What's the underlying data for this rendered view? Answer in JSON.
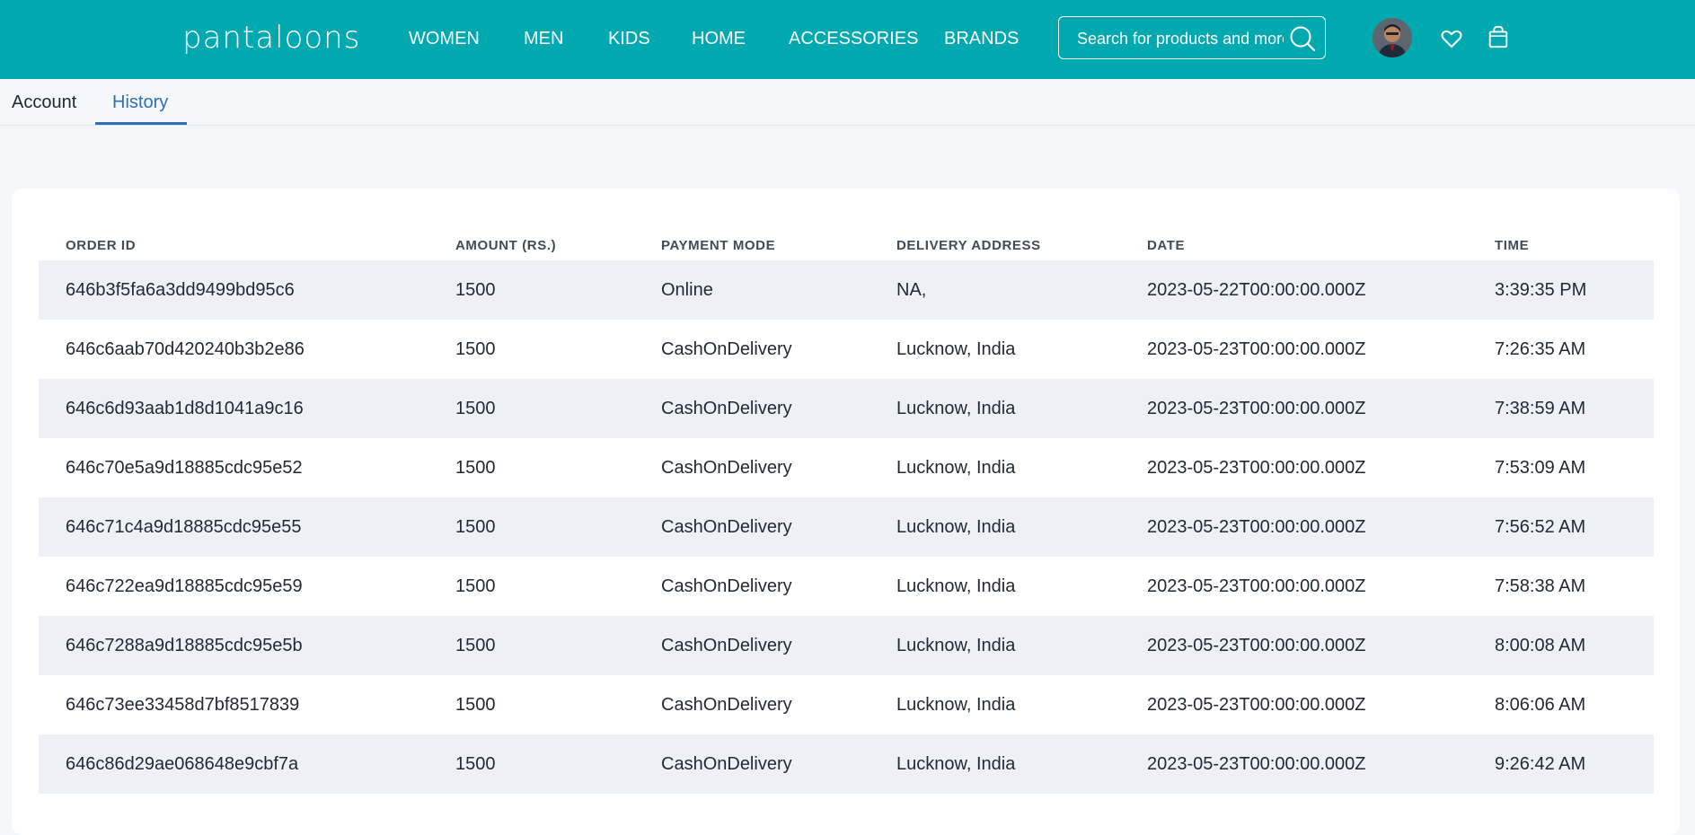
{
  "header": {
    "logo": "pantaloons",
    "nav": [
      "WOMEN",
      "MEN",
      "KIDS",
      "HOME",
      "ACCESSORIES",
      "BRANDS"
    ],
    "search_placeholder": "Search for products and more...",
    "icons": [
      "search-icon",
      "avatar",
      "heart-icon",
      "shopping-bag-icon"
    ],
    "brand_color": "#00a8b0"
  },
  "tabs": [
    {
      "label": "Account",
      "active": false
    },
    {
      "label": "History",
      "active": true
    }
  ],
  "table": {
    "columns": [
      "ORDER ID",
      "AMOUNT (RS.)",
      "PAYMENT MODE",
      "DELIVERY ADDRESS",
      "DATE",
      "TIME"
    ],
    "rows": [
      [
        "646b3f5fa6a3dd9499bd95c6",
        "1500",
        "Online",
        "NA,",
        "2023-05-22T00:00:00.000Z",
        "3:39:35 PM"
      ],
      [
        "646c6aab70d420240b3b2e86",
        "1500",
        "CashOnDelivery",
        "Lucknow, India",
        "2023-05-23T00:00:00.000Z",
        "7:26:35 AM"
      ],
      [
        "646c6d93aab1d8d1041a9c16",
        "1500",
        "CashOnDelivery",
        "Lucknow, India",
        "2023-05-23T00:00:00.000Z",
        "7:38:59 AM"
      ],
      [
        "646c70e5a9d18885cdc95e52",
        "1500",
        "CashOnDelivery",
        "Lucknow, India",
        "2023-05-23T00:00:00.000Z",
        "7:53:09 AM"
      ],
      [
        "646c71c4a9d18885cdc95e55",
        "1500",
        "CashOnDelivery",
        "Lucknow, India",
        "2023-05-23T00:00:00.000Z",
        "7:56:52 AM"
      ],
      [
        "646c722ea9d18885cdc95e59",
        "1500",
        "CashOnDelivery",
        "Lucknow, India",
        "2023-05-23T00:00:00.000Z",
        "7:58:38 AM"
      ],
      [
        "646c7288a9d18885cdc95e5b",
        "1500",
        "CashOnDelivery",
        "Lucknow, India",
        "2023-05-23T00:00:00.000Z",
        "8:00:08 AM"
      ],
      [
        "646c73ee33458d7bf8517839",
        "1500",
        "CashOnDelivery",
        "Lucknow, India",
        "2023-05-23T00:00:00.000Z",
        "8:06:06 AM"
      ],
      [
        "646c86d29ae068648e9cbf7a",
        "1500",
        "CashOnDelivery",
        "Lucknow, India",
        "2023-05-23T00:00:00.000Z",
        "9:26:42 AM"
      ]
    ]
  }
}
